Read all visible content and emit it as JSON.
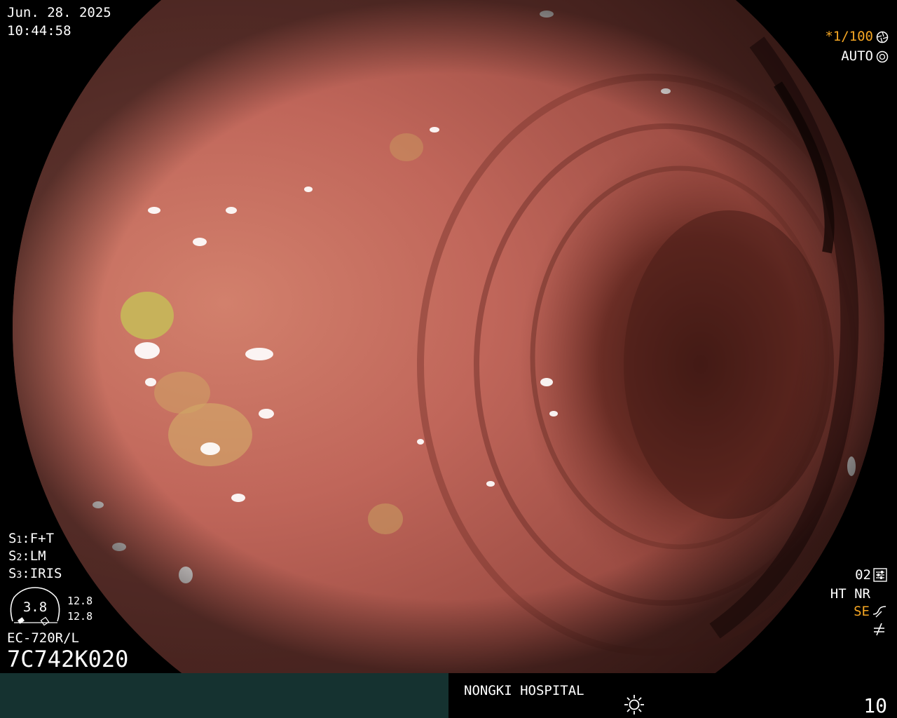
{
  "overlay": {
    "date": "Jun. 28. 2025",
    "time": "10:44:58",
    "shutter": "*1/100",
    "mode": "AUTO",
    "s1": {
      "key": "S",
      "num": "1",
      "value": ":F+T"
    },
    "s2": {
      "key": "S",
      "num": "2",
      "value": ":LM"
    },
    "s3": {
      "key": "S",
      "num": "3",
      "value": ":IRIS"
    },
    "dial_value": "3.8",
    "dial_a": "12.8",
    "dial_b": "12.8",
    "scope_model": "EC-720R/L",
    "serial": "7C742K020",
    "o2": "02",
    "ht_nr": "HT NR",
    "se": "SE"
  },
  "footer": {
    "hospital": "NONGKI HOSPITAL",
    "page_number": "10"
  },
  "icons": {
    "shutter": "aperture-icon",
    "auto": "aperture-auto-icon",
    "o2": "settings-sliders-icon",
    "se": "enhance-curve-icon",
    "filter": "filter-symbol-icon",
    "brightness": "sun-icon"
  },
  "colors": {
    "accent": "#f5a623",
    "footer_left": "#153230"
  }
}
